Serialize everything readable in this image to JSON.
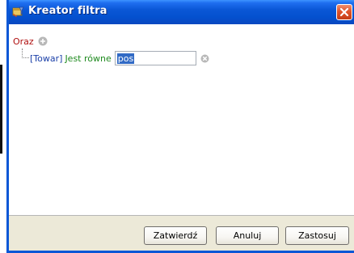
{
  "window": {
    "title": "Kreator filtra",
    "title_icon": "filter-wizard-icon",
    "close_icon": "close-icon"
  },
  "filter": {
    "root_operator": "Oraz",
    "add_icon": "add-condition-icon",
    "conditions": [
      {
        "field": "[Towar]",
        "operator": "Jest równe",
        "value": "pos",
        "remove_icon": "remove-condition-icon"
      }
    ]
  },
  "buttons": {
    "ok": "Zatwierdź",
    "cancel": "Anuluj",
    "apply": "Zastosuj"
  },
  "colors": {
    "titlebar": "#0a57d6",
    "root_operator": "#b01010",
    "field": "#1a3fa8",
    "operator": "#1e8a1e",
    "selection": "#316ac5",
    "button_bar": "#ece9d8"
  }
}
